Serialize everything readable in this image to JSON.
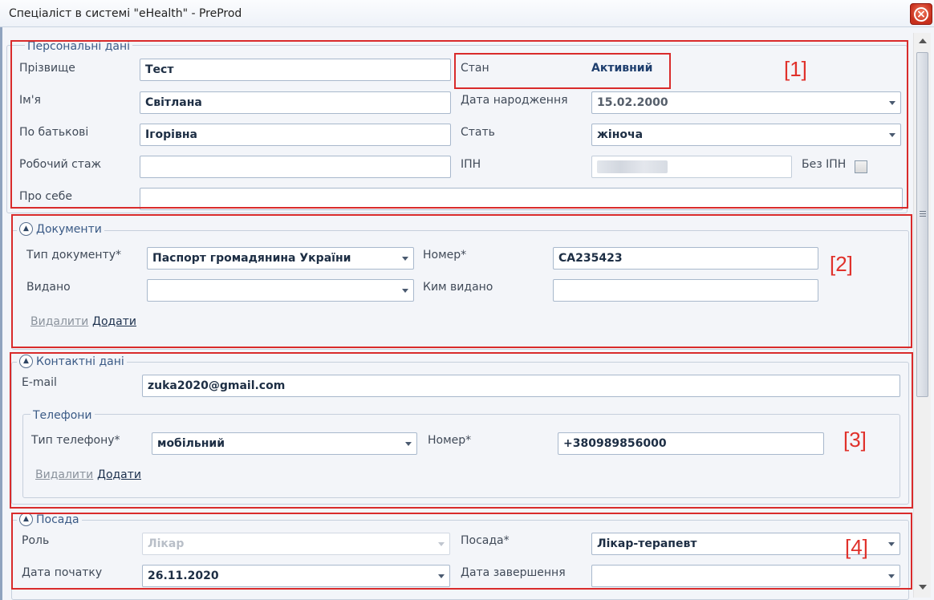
{
  "window": {
    "title": "Спеціаліст в системі \"eHealth\" - PreProd"
  },
  "personal": {
    "legend": "Персональні дані",
    "surname_label": "Прізвище",
    "surname_value": "Тест",
    "name_label": "Ім'я",
    "name_value": "Світлана",
    "patronymic_label": "По батькові",
    "patronymic_value": "Ігорівна",
    "experience_label": "Робочий стаж",
    "experience_value": "",
    "about_label": "Про себе",
    "about_value": "",
    "status_label": "Стан",
    "status_value": "Активний",
    "birthdate_label": "Дата народження",
    "birthdate_value": "15.02.2000",
    "gender_label": "Стать",
    "gender_value": "жіноча",
    "tax_id_label": "ІПН",
    "tax_id_value": "",
    "no_tax_id_label": "Без ІПН",
    "no_tax_id_checked": false
  },
  "documents": {
    "legend": "Документи",
    "doc_type_label": "Тип документу*",
    "doc_type_value": "Паспорт громадянина України",
    "number_label": "Номер*",
    "number_value": "CA235423",
    "issued_label": "Видано",
    "issued_value": "",
    "issued_by_label": "Ким видано",
    "issued_by_value": "",
    "delete_label": "Видалити",
    "add_label": "Додати"
  },
  "contacts": {
    "legend": "Контактні дані",
    "email_label": "E-mail",
    "email_value": "zuka2020@gmail.com",
    "phones": {
      "legend": "Телефони",
      "type_label": "Тип телефону*",
      "type_value": "мобільний",
      "number_label": "Номер*",
      "number_value": "+380989856000",
      "delete_label": "Видалити",
      "add_label": "Додати"
    }
  },
  "position": {
    "legend": "Посада",
    "role_label": "Роль",
    "role_value": "Лікар",
    "position_label": "Посада*",
    "position_value": "Лікар-терапевт",
    "start_label": "Дата початку",
    "start_value": "26.11.2020",
    "end_label": "Дата завершення",
    "end_value": ""
  },
  "annotations": {
    "a1": "[1]",
    "a2": "[2]",
    "a3": "[3]",
    "a4": "[4]"
  },
  "colors": {
    "annotation": "#e0312b",
    "accent": "#1f3f6e"
  },
  "icons": {
    "close": "close-icon",
    "collapse": "collapse-icon",
    "dropdown": "chevron-down-icon"
  }
}
